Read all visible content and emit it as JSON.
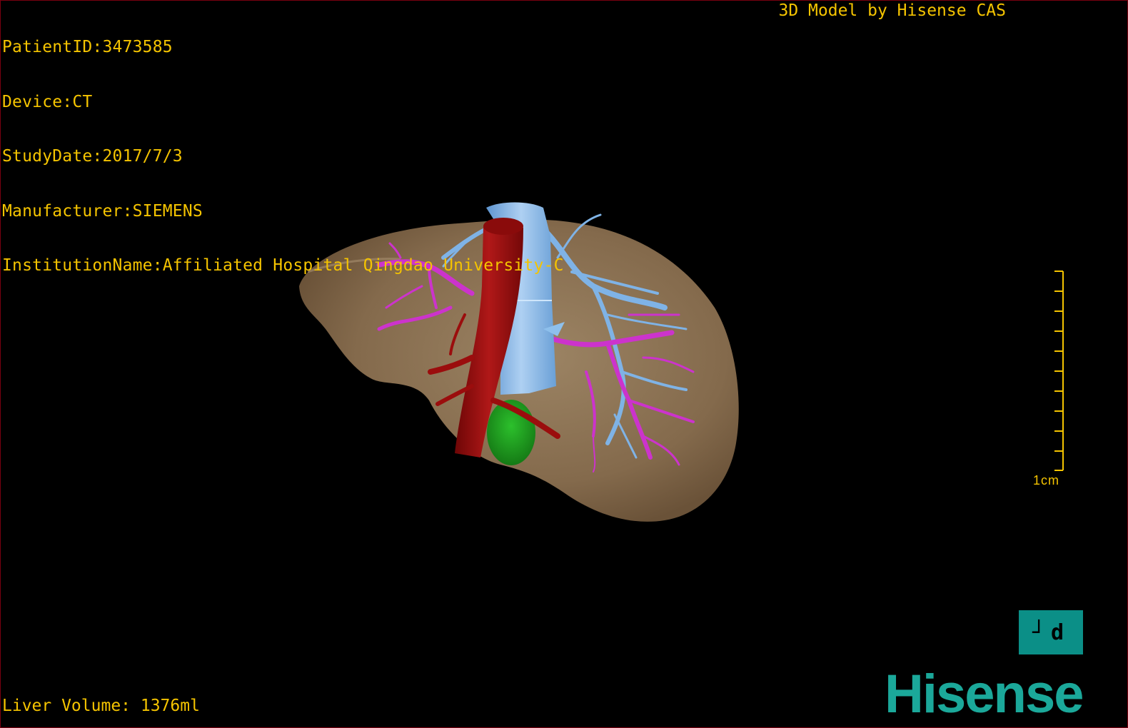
{
  "overlay": {
    "patient_id": "PatientID:3473585",
    "device": "Device:CT",
    "study_date": "StudyDate:2017/7/3",
    "manufacturer": "Manufacturer:SIEMENS",
    "institution": "InstitutionName:Affiliated Hospital Qingdao University-C",
    "model_credit": "3D Model by Hisense CAS",
    "liver_volume": "Liver Volume: 1376ml"
  },
  "scale": {
    "label": "1cm"
  },
  "orientation": {
    "label": "┘d"
  },
  "brand": {
    "logo_text": "Hisense"
  },
  "colors": {
    "overlay_text": "#f5c400",
    "liver": "#8b7355",
    "artery": "#9b0d0d",
    "vein": "#7fb3e6",
    "portal_vein": "#cc33cc",
    "gallbladder": "#1a9a1a",
    "brand": "#1ba89a",
    "orientation_box": "#0b8f87"
  }
}
